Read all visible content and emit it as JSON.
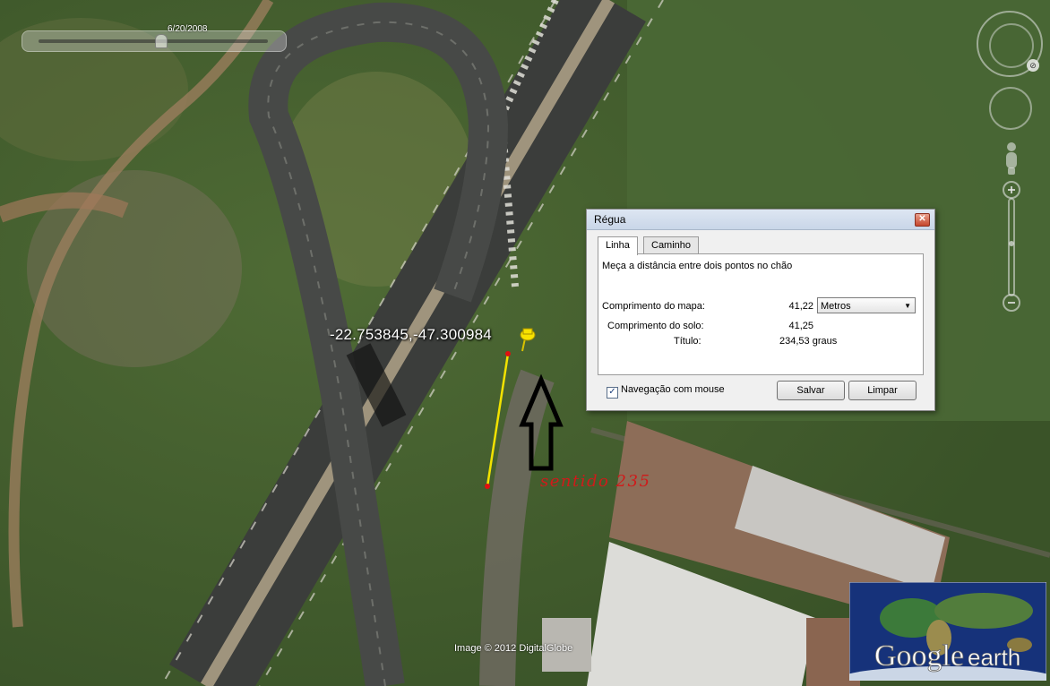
{
  "timeslider": {
    "date": "6/20/2008",
    "position": 0.49
  },
  "map": {
    "coordinate_label": "-22.753845,-47.300984",
    "direction_label": "sentido 235",
    "copyright": "Image © 2012 DigitalGlobe",
    "measure_line_color": "#f2e200",
    "measure_point_color": "#e01010",
    "direction_label_color": "#d01a1a"
  },
  "ruler": {
    "title": "Régua",
    "close_icon": "close-icon",
    "tabs": [
      {
        "label": "Linha",
        "active": true
      },
      {
        "label": "Caminho",
        "active": false
      }
    ],
    "description": "Meça a distância entre dois pontos no chão",
    "map_length_label": "Comprimento do mapa:",
    "map_length_value": "41,22",
    "units": "Metros",
    "ground_length_label": "Comprimento do solo:",
    "ground_length_value": "41,25",
    "heading_label": "Título:",
    "heading_value": "234,53 graus",
    "mouse_nav_label": "Navegação com mouse",
    "mouse_nav_checked": true,
    "save_label": "Salvar",
    "clear_label": "Limpar"
  },
  "logo": {
    "word1": "Google",
    "word2": "earth"
  }
}
